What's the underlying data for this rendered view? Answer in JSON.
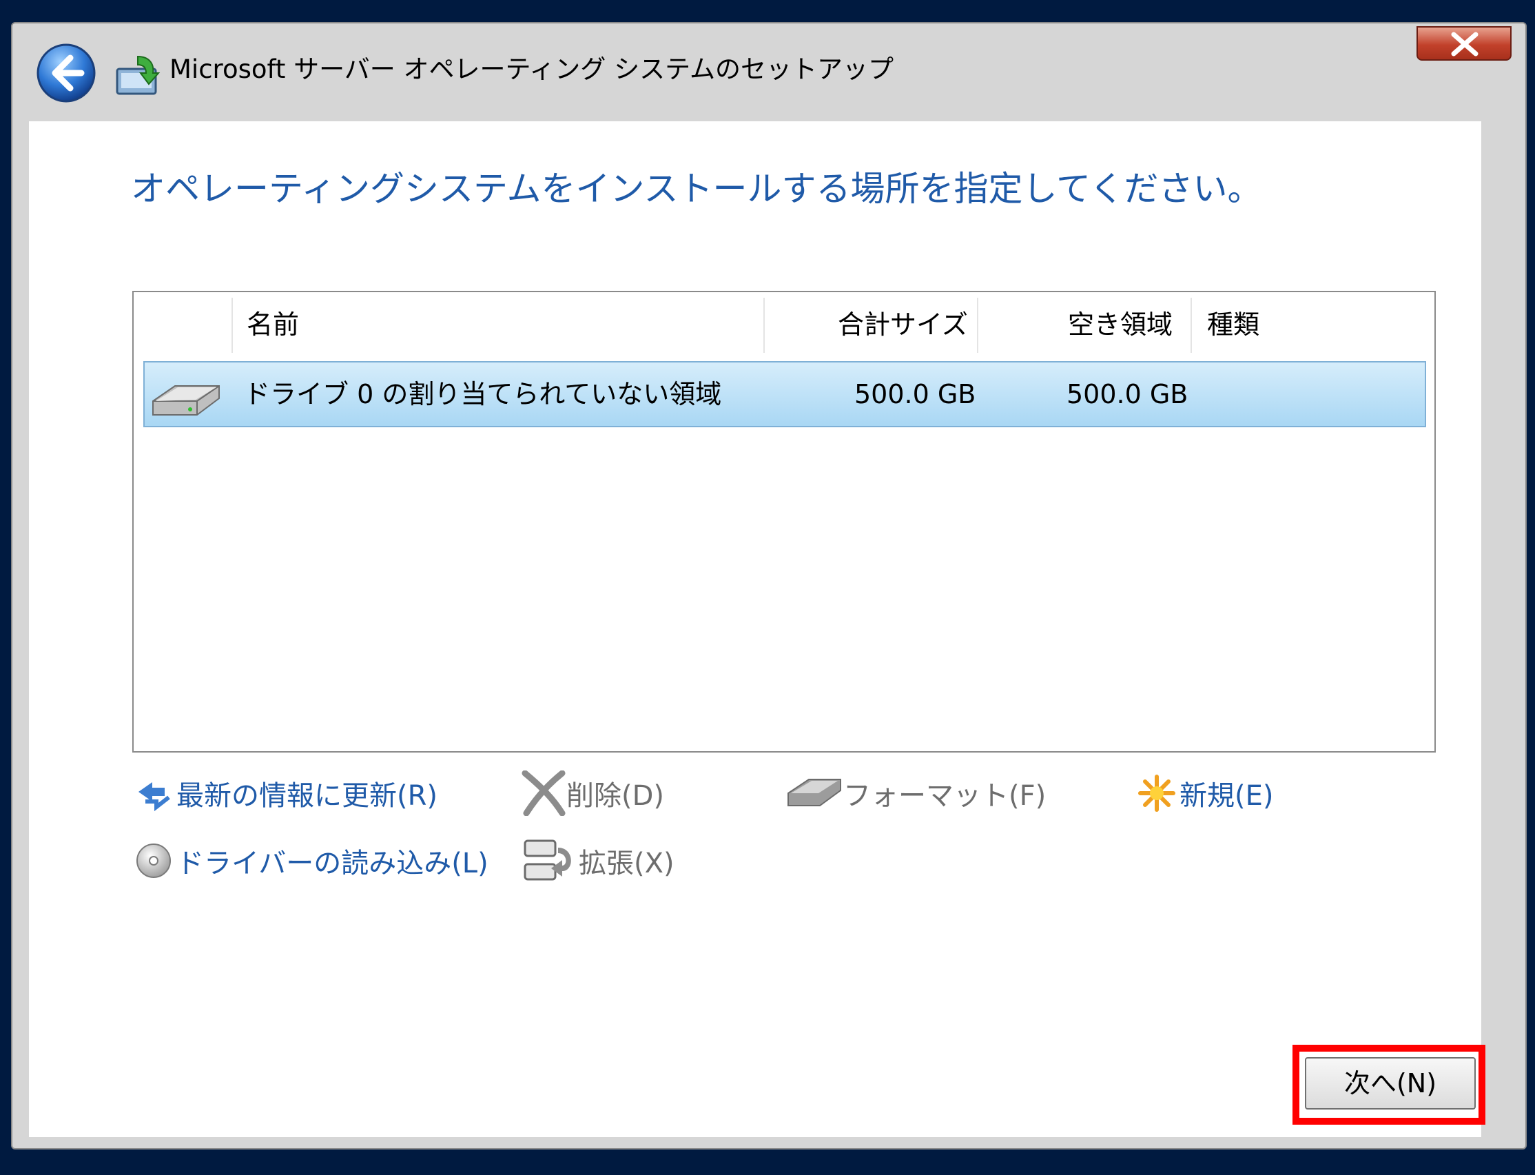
{
  "window": {
    "title": "Microsoft サーバー オペレーティング システムのセットアップ"
  },
  "page": {
    "heading": "オペレーティングシステムをインストールする場所を指定してください。"
  },
  "table": {
    "columns": [
      "名前",
      "合計サイズ",
      "空き領域",
      "種類"
    ],
    "rows": [
      {
        "name": "ドライブ 0 の割り当てられていない領域",
        "total": "500.0 GB",
        "free": "500.0 GB",
        "type": ""
      }
    ]
  },
  "actions": {
    "refresh": "最新の情報に更新(R)",
    "delete": "削除(D)",
    "format": "フォーマット(F)",
    "new": "新規(E)",
    "load_driver": "ドライバーの読み込み(L)",
    "extend": "拡張(X)"
  },
  "buttons": {
    "next": "次へ(N)"
  },
  "colors": {
    "accent": "#1f5aa8",
    "selected_row": "#a9d7f4",
    "highlight_box": "#ff0000",
    "desktop": "#001a40"
  }
}
